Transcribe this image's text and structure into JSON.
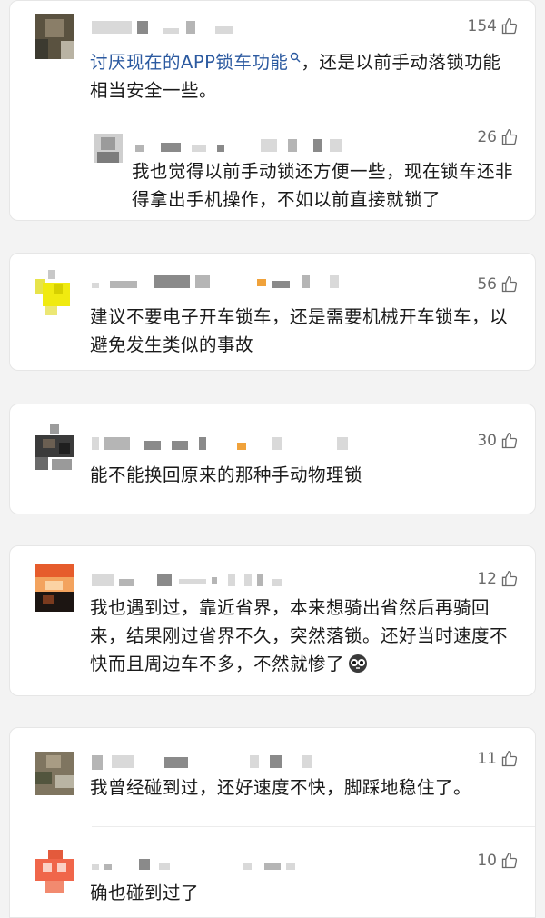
{
  "comments": [
    {
      "likes": "154",
      "text_link": "讨厌现在的APP锁车功能",
      "text_rest": "，还是以前手动落锁功能相当安全一些。",
      "reply": {
        "likes": "26",
        "text": "我也觉得以前手动锁还方便一些，现在锁车还非得拿出手机操作，不如以前直接就锁了"
      }
    },
    {
      "likes": "56",
      "text": "建议不要电子开车锁车，还是需要机械开车锁车，以避免发生类似的事故"
    },
    {
      "likes": "30",
      "text": "能不能换回原来的那种手动物理锁"
    },
    {
      "likes": "12",
      "text": "我也遇到过，靠近省界，本来想骑出省然后再骑回来，结果刚过省界不久，突然落锁。还好当时速度不快而且周边车不多，不然就惨了",
      "emoji": "owl-face-emoji"
    },
    {
      "likes": "11",
      "text": "我曾经碰到过，还好速度不快，脚踩地稳住了。",
      "reply": {
        "likes": "10",
        "text": "确也碰到过了"
      }
    }
  ],
  "icons": {
    "like": "thumbs-up-icon",
    "search": "search-icon"
  }
}
